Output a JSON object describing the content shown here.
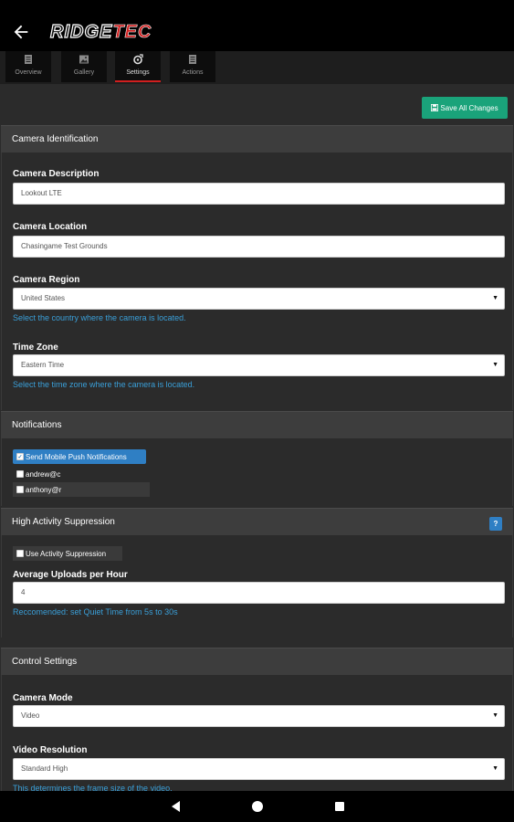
{
  "app": {
    "logo_part1": "RIDGE",
    "logo_part2": "TEC"
  },
  "tabs": [
    {
      "label": "Overview",
      "icon": "list-icon"
    },
    {
      "label": "Gallery",
      "icon": "image-icon"
    },
    {
      "label": "Settings",
      "icon": "settings-icon",
      "active": true
    },
    {
      "label": "Actions",
      "icon": "list-icon"
    }
  ],
  "toolbar": {
    "save_label": "Save All Changes"
  },
  "camera_identification": {
    "title": "Camera Identification",
    "description_label": "Camera Description",
    "description_value": "Lookout LTE",
    "location_label": "Camera Location",
    "location_value": "Chasingame Test Grounds",
    "region_label": "Camera Region",
    "region_value": "United States",
    "region_help": "Select the country where the camera is located.",
    "timezone_label": "Time Zone",
    "timezone_value": "Eastern Time",
    "timezone_help": "Select the time zone where the camera is located."
  },
  "notifications": {
    "title": "Notifications",
    "push_label": "Send Mobile Push Notifications",
    "push_checked": true,
    "users": [
      "andrew@c",
      "anthony@r"
    ]
  },
  "high_activity": {
    "title": "High Activity Suppression",
    "help_badge": "?",
    "suppression_label": "Use Activity Suppression",
    "uploads_label": "Average Uploads per Hour",
    "uploads_value": "4",
    "uploads_help": "Reccomended: set Quiet Time from 5s to 30s"
  },
  "control_settings": {
    "title": "Control Settings",
    "mode_label": "Camera Mode",
    "mode_value": "Video",
    "resolution_label": "Video Resolution",
    "resolution_value": "Standard High",
    "resolution_help": "This determines the frame size of the video."
  },
  "colors": {
    "accent_green": "#1aa37a",
    "accent_blue": "#2f7fc4",
    "help_text": "#3a9fd8",
    "brand_red": "#d01f1f"
  }
}
